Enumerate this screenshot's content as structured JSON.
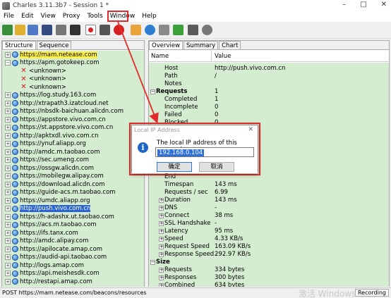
{
  "window": {
    "title": "Charles 3.11.3b7 - Session 1 *",
    "controls": [
      "–",
      "□",
      "✕"
    ]
  },
  "menu": [
    "File",
    "Edit",
    "View",
    "Proxy",
    "Tools",
    "Window",
    "Help"
  ],
  "toolbar": {
    "icons": [
      "new-session-icon",
      "open-icon",
      "import-icon",
      "save-icon",
      "trash-icon",
      "binoculars-icon",
      "record-icon",
      "throttle-icon",
      "breakpoint-icon",
      "compose-icon",
      "repeat-icon",
      "edit-icon",
      "validate-icon",
      "tools-icon",
      "settings-icon"
    ]
  },
  "left_tabs": [
    "Structure",
    "Sequence"
  ],
  "tree": [
    {
      "type": "host",
      "label": "https://mam.netease.com",
      "highlight": "yellow"
    },
    {
      "type": "host",
      "label": "https://apm.gotokeep.com",
      "expanded": true
    },
    {
      "type": "child",
      "label": "<unknown>"
    },
    {
      "type": "child",
      "label": "<unknown>"
    },
    {
      "type": "child",
      "label": "<unknown>"
    },
    {
      "type": "host",
      "label": "https://log.study.163.com"
    },
    {
      "type": "host",
      "label": "http://xtrapath3.izatcloud.net"
    },
    {
      "type": "host",
      "label": "https://nbsdk-baichuan.alicdn.com"
    },
    {
      "type": "host",
      "label": "https://appstore.vivo.com.cn"
    },
    {
      "type": "host",
      "label": "https://st.appstore.vivo.com.cn"
    },
    {
      "type": "host",
      "label": "http://apktxdl.vivo.com.cn"
    },
    {
      "type": "host",
      "label": "https://ynuf.aliapp.org"
    },
    {
      "type": "host",
      "label": "http://amdc.m.taobao.com"
    },
    {
      "type": "host",
      "label": "https://sec.umeng.com"
    },
    {
      "type": "host",
      "label": "https://ossgw.alicdn.com"
    },
    {
      "type": "host",
      "label": "https://mobilegw.alipay.com"
    },
    {
      "type": "host",
      "label": "https://download.alicdn.com"
    },
    {
      "type": "host",
      "label": "https://guide-acs.m.taobao.com"
    },
    {
      "type": "host",
      "label": "https://umdc.aliapp.org"
    },
    {
      "type": "host",
      "label": "http://push.vivo.com.cn",
      "highlight": "blue"
    },
    {
      "type": "host",
      "label": "https://h-adashx.ut.taobao.com"
    },
    {
      "type": "host",
      "label": "https://acs.m.taobao.com"
    },
    {
      "type": "host",
      "label": "https://ifs.tanx.com"
    },
    {
      "type": "host",
      "label": "http://amdc.alipay.com"
    },
    {
      "type": "host",
      "label": "https://apilocate.amap.com"
    },
    {
      "type": "host",
      "label": "https://audid-api.taobao.com"
    },
    {
      "type": "host",
      "label": "http://logs.amap.com"
    },
    {
      "type": "host",
      "label": "https://api.meishesdk.com"
    },
    {
      "type": "host",
      "label": "http://restapi.amap.com"
    }
  ],
  "right_tabs": [
    "Overview",
    "Summary",
    "Chart"
  ],
  "grid_columns": {
    "name": "Name",
    "value": "Value"
  },
  "overview_rows": [
    {
      "indent": 1,
      "name": "Host",
      "value": "http://push.vivo.com.cn"
    },
    {
      "indent": 1,
      "name": "Path",
      "value": "/"
    },
    {
      "indent": 1,
      "name": "Notes",
      "value": ""
    },
    {
      "indent": 0,
      "name": "Requests",
      "value": "1",
      "section": true
    },
    {
      "indent": 1,
      "name": "Completed",
      "value": "1"
    },
    {
      "indent": 1,
      "name": "Incomplete",
      "value": "0"
    },
    {
      "indent": 1,
      "name": "Failed",
      "value": "0"
    },
    {
      "indent": 1,
      "name": "Blocked",
      "value": "0"
    },
    {
      "indent": 1,
      "name": "DNS",
      "value": "0"
    },
    {
      "indent": 1,
      "name": "Connects",
      "value": "1"
    },
    {
      "indent": 1,
      "name": "TLS Handshakes",
      "value": "0"
    },
    {
      "indent": 1,
      "name": "Kept Alive",
      "value": "0"
    },
    {
      "indent": 0,
      "name": "Timing",
      "value": "",
      "section": true
    },
    {
      "indent": 1,
      "name": "Start",
      "value": ""
    },
    {
      "indent": 1,
      "name": "End",
      "value": ""
    },
    {
      "indent": 1,
      "name": "Timespan",
      "value": "143 ms"
    },
    {
      "indent": 1,
      "name": "Requests / sec",
      "value": "6.99"
    },
    {
      "indent": 1,
      "name": "Duration",
      "value": "143 ms",
      "expander": true
    },
    {
      "indent": 1,
      "name": "DNS",
      "value": "-",
      "expander": true
    },
    {
      "indent": 1,
      "name": "Connect",
      "value": "38 ms",
      "expander": true
    },
    {
      "indent": 1,
      "name": "SSL Handshake",
      "value": "-",
      "expander": true
    },
    {
      "indent": 1,
      "name": "Latency",
      "value": "95 ms",
      "expander": true
    },
    {
      "indent": 1,
      "name": "Speed",
      "value": "4.33 KB/s",
      "expander": true
    },
    {
      "indent": 1,
      "name": "Request Speed",
      "value": "163.09 KB/s",
      "expander": true
    },
    {
      "indent": 1,
      "name": "Response Speed",
      "value": "292.97 KB/s",
      "expander": true
    },
    {
      "indent": 0,
      "name": "Size",
      "value": "",
      "section": true
    },
    {
      "indent": 1,
      "name": "Requests",
      "value": "334 bytes",
      "expander": true
    },
    {
      "indent": 1,
      "name": "Responses",
      "value": "300 bytes",
      "expander": true
    },
    {
      "indent": 1,
      "name": "Combined",
      "value": "634 bytes",
      "expander": true
    }
  ],
  "status": {
    "text": "POST https://mam.netease.com/beacons/resources",
    "recording": "Recording",
    "watermark": "激活 Windows"
  },
  "dialog": {
    "title": "Local IP Address",
    "close": "✕",
    "message": "The local IP address of this system is:",
    "ip": "192.168.0.104",
    "ok": "确定",
    "cancel": "取消"
  },
  "colors": {
    "pane_green": "#d4ecd0",
    "highlight_red": "#e22b2b",
    "selection_blue": "#2a64d3",
    "selection_yellow": "#fff14a"
  }
}
